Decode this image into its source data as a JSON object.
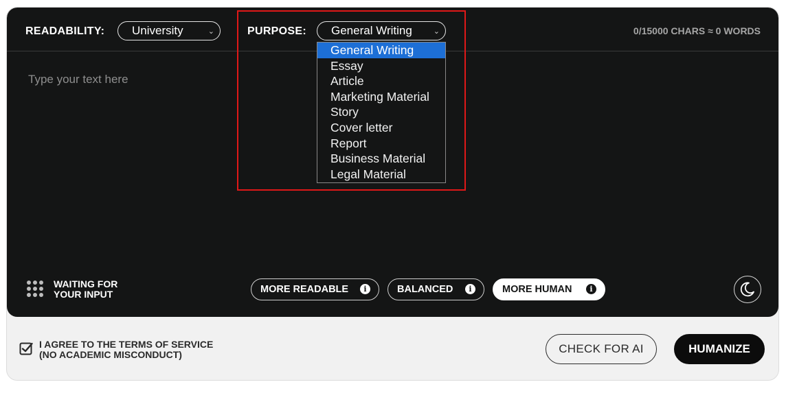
{
  "toolbar": {
    "readability_label": "READABILITY:",
    "readability_value": "University",
    "purpose_label": "PURPOSE:",
    "purpose_value": "General Writing",
    "counter": "0/15000 CHARS ≈ 0 WORDS"
  },
  "purpose_options": [
    "General Writing",
    "Essay",
    "Article",
    "Marketing Material",
    "Story",
    "Cover letter",
    "Report",
    "Business Material",
    "Legal Material"
  ],
  "editor": {
    "placeholder": "Type your text here"
  },
  "status": {
    "line1": "WAITING FOR",
    "line2": "YOUR INPUT"
  },
  "modes": {
    "more_readable": "MORE READABLE",
    "balanced": "BALANCED",
    "more_human": "MORE HUMAN",
    "selected": "MORE HUMAN"
  },
  "footer": {
    "agree_line1": "I AGREE TO THE TERMS OF SERVICE",
    "agree_line2": "(NO ACADEMIC MISCONDUCT)",
    "agree_checked": true,
    "check_button": "CHECK FOR AI",
    "humanize_button": "HUMANIZE"
  },
  "icons": {
    "chevron": "chevron-down-icon",
    "info": "info-icon",
    "moon": "moon-icon",
    "status": "dots-grid-icon",
    "checkbox": "checkbox-checked-icon"
  },
  "colors": {
    "panel_dark": "#141515",
    "selection": "#1d6fd6",
    "highlight": "#e01818"
  }
}
